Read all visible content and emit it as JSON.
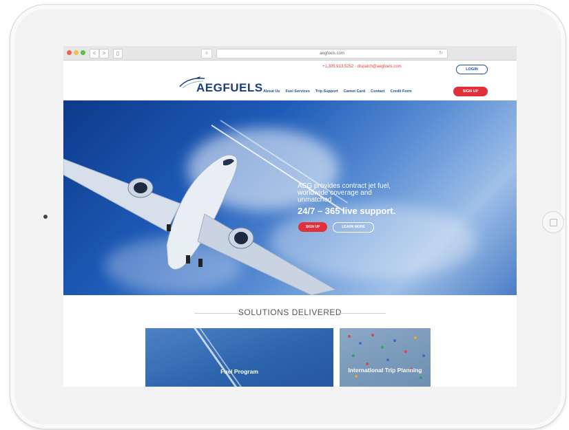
{
  "browser": {
    "url": "aegfuels.com",
    "back": "<",
    "forward": ">",
    "sidebar": "▯",
    "reader": "≡",
    "reload": "↻"
  },
  "header": {
    "contact_line": "+1.305.913.5252 · dispatch@aegfuels.com",
    "login_label": "LOGIN",
    "logo_text": "AEGFUELS",
    "nav": [
      "About Us",
      "Fuel Services",
      "Trip Support",
      "Carnet Card",
      "Contact",
      "Credit Form"
    ],
    "signup_label": "SIGN UP"
  },
  "hero": {
    "line1": "AEG provides contract jet fuel,",
    "line2": "worldwide coverage and",
    "line3": "unmatched",
    "strong": "24/7 – 365 live support.",
    "signup_label": "SIGN UP",
    "learn_label": "LEARN MORE"
  },
  "solutions": {
    "title": "SOLUTIONS DELIVERED",
    "cards": [
      {
        "label": "Fuel Program"
      },
      {
        "label": "International Trip Planning"
      }
    ]
  },
  "colors": {
    "brand_blue": "#1b4f9c",
    "accent_red": "#e0303a",
    "logo_navy": "#1a3d7d"
  },
  "icons": {
    "camera": "front-camera-icon",
    "home": "home-button-icon"
  }
}
